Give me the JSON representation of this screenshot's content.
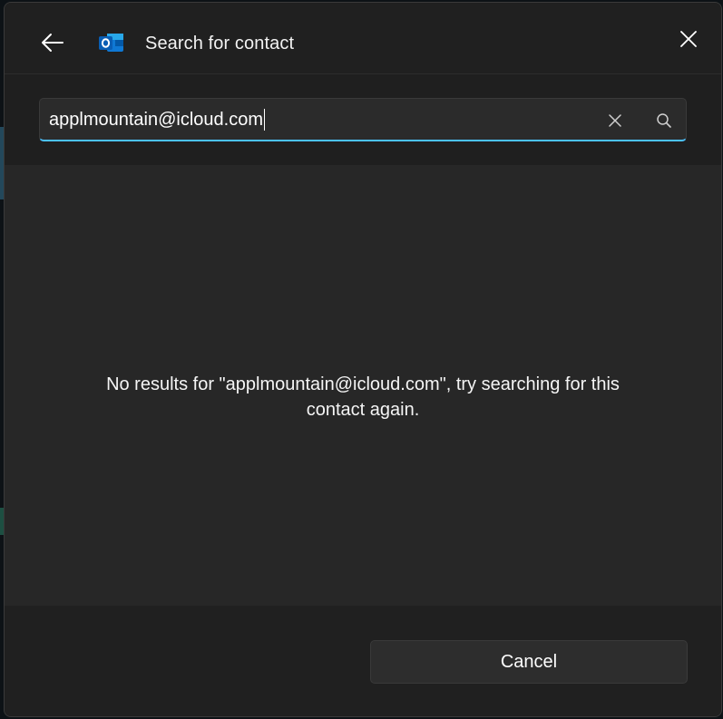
{
  "dialog": {
    "title": "Search for contact",
    "icons": {
      "back": "back-arrow-icon",
      "app": "outlook-icon",
      "close": "close-icon"
    }
  },
  "search": {
    "value": "applmountain@icloud.com",
    "icons": {
      "clear": "clear-icon",
      "search": "search-icon"
    },
    "accent_color": "#4cc2ff"
  },
  "results": {
    "message": "No results for \"applmountain@icloud.com\", try searching for this contact again."
  },
  "footer": {
    "cancel_label": "Cancel"
  }
}
